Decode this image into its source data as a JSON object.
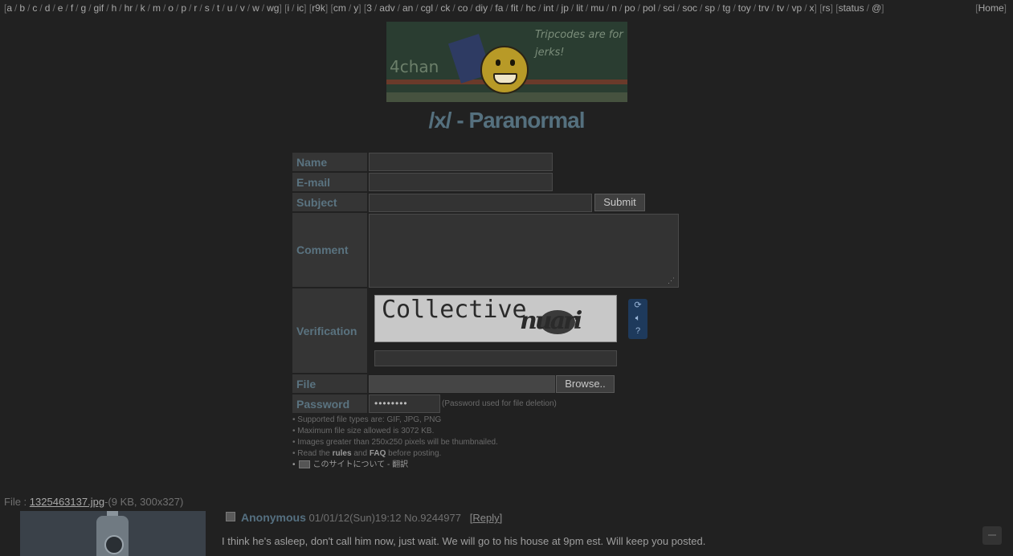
{
  "nav": {
    "groups": [
      [
        "a",
        "b",
        "c",
        "d",
        "e",
        "f",
        "g",
        "gif",
        "h",
        "hr",
        "k",
        "m",
        "o",
        "p",
        "r",
        "s",
        "t",
        "u",
        "v",
        "w",
        "wg"
      ],
      [
        "i",
        "ic"
      ],
      [
        "r9k"
      ],
      [
        "cm",
        "y"
      ],
      [
        "3",
        "adv",
        "an",
        "cgl",
        "ck",
        "co",
        "diy",
        "fa",
        "fit",
        "hc",
        "int",
        "jp",
        "lit",
        "mu",
        "n",
        "po",
        "pol",
        "sci",
        "soc",
        "sp",
        "tg",
        "toy",
        "trv",
        "tv",
        "vp",
        "x"
      ],
      [
        "rs"
      ],
      [
        "status",
        "@"
      ]
    ],
    "home": "Home"
  },
  "banner": {
    "left_text": "4chan",
    "right_text": "Tripcodes are for jerks!"
  },
  "title": "/x/ - Paranormal",
  "form": {
    "labels": {
      "name": "Name",
      "email": "E-mail",
      "subject": "Subject",
      "comment": "Comment",
      "verification": "Verification",
      "file": "File",
      "password": "Password"
    },
    "submit": "Submit",
    "browse": "Browse..",
    "password_value": "••••••••",
    "password_note": "(Password used for file deletion)",
    "captcha_word1": "Collective",
    "captcha_word2": "nuari",
    "captcha_icons": [
      "refresh-icon",
      "audio-icon",
      "help-icon"
    ],
    "rules": {
      "line1": "• Supported file types are: GIF, JPG, PNG",
      "line2": "• Maximum file size allowed is 3072 KB.",
      "line3": "• Images greater than 250x250 pixels will be thumbnailed.",
      "line4_pre": "• Read the ",
      "line4_rules": "rules",
      "line4_mid": " and ",
      "line4_faq": "FAQ",
      "line4_post": " before posting.",
      "line5_pre": "•",
      "line5_jp": "このサイトについて - 翻訳"
    }
  },
  "thread": {
    "file_label": "File : ",
    "file_name": "1325463137.jpg",
    "file_meta": "-(9 KB, 300x327)",
    "name": "Anonymous",
    "datetime": "01/01/12(Sun)19:12",
    "number": "No.9244977",
    "reply_open": "[",
    "reply_label": "Reply",
    "reply_close": "]",
    "comment": "I think he's asleep, don't call him now, just wait. We will go to his house at 9pm est. Will keep you posted."
  },
  "colors": {
    "background": "#212121",
    "accent": "#55707e",
    "label_bg": "#353535"
  }
}
